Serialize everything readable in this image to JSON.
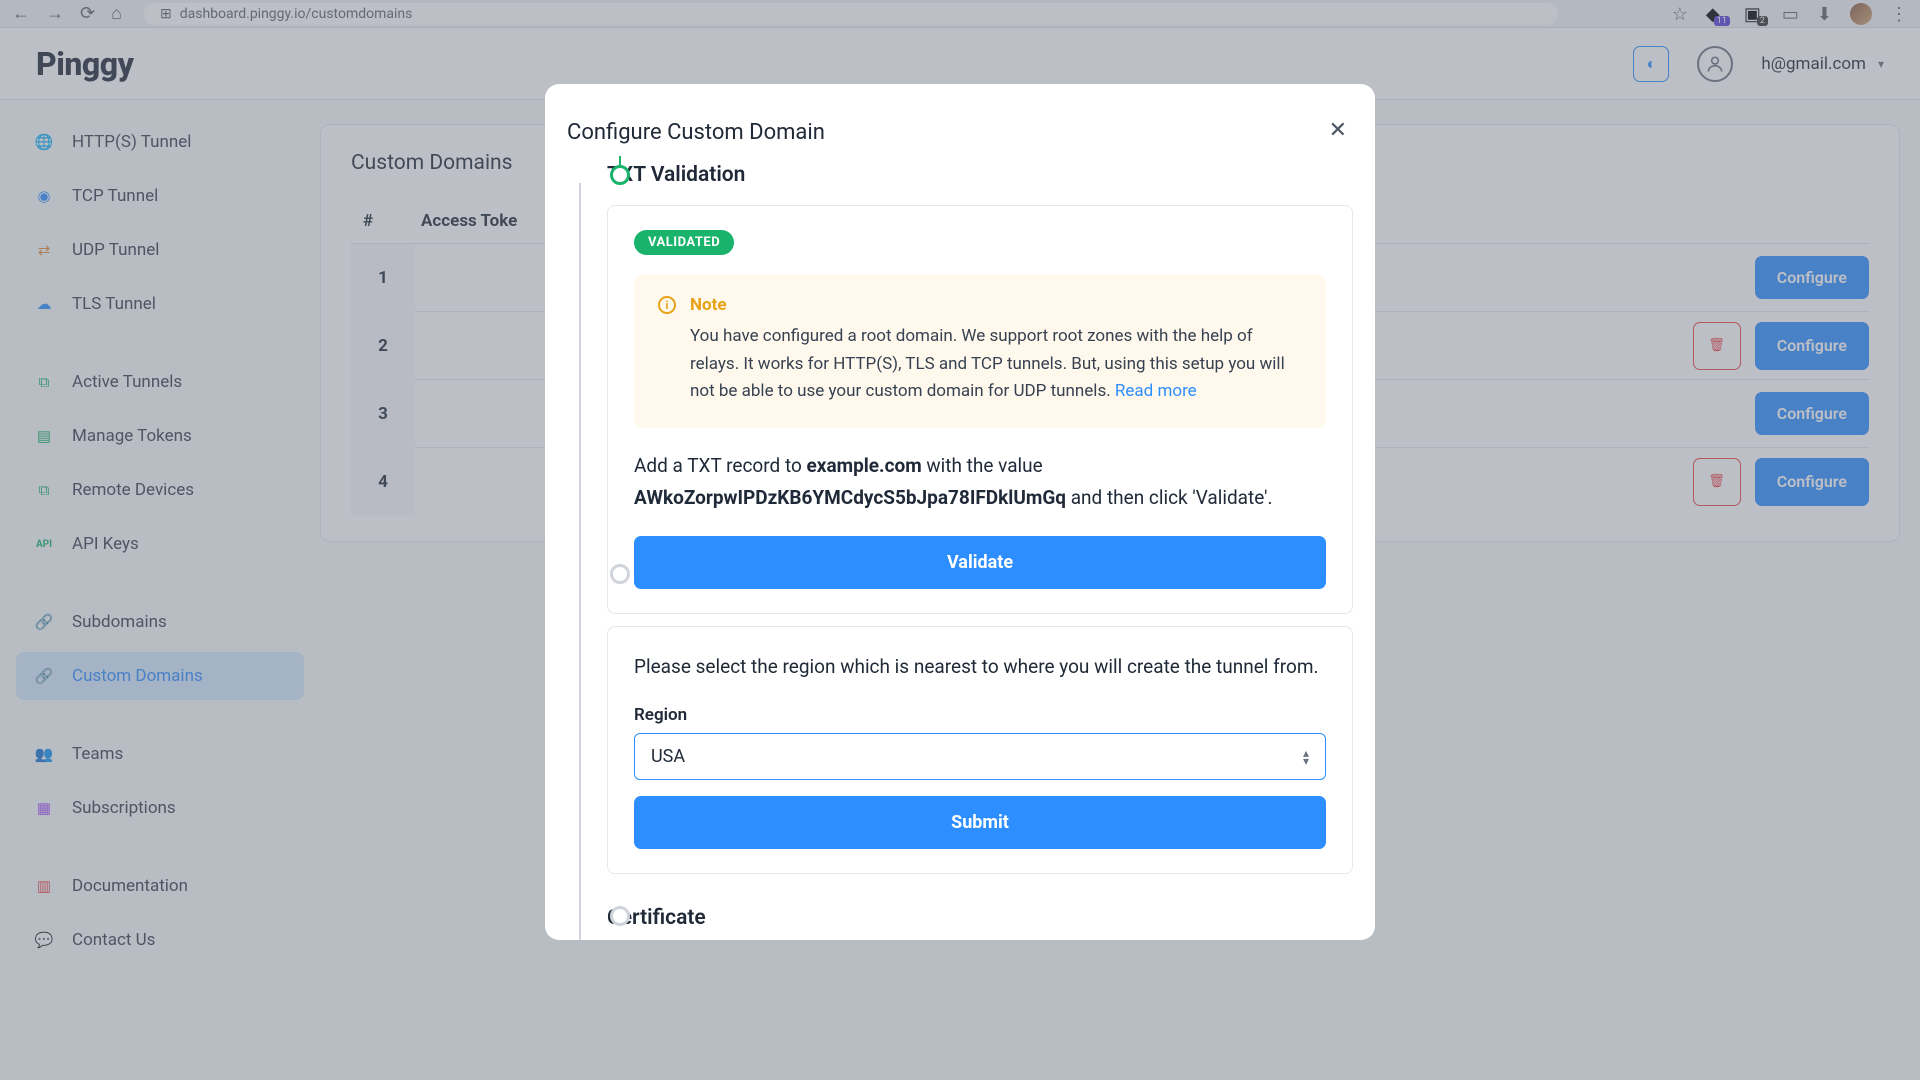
{
  "browser": {
    "url": "dashboard.pinggy.io/customdomains",
    "ext_badge1": "11",
    "ext_badge2": "2"
  },
  "header": {
    "logo": "Pinggy",
    "email": "h@gmail.com"
  },
  "sidebar": {
    "group1": [
      {
        "label": "HTTP(S) Tunnel"
      },
      {
        "label": "TCP Tunnel"
      },
      {
        "label": "UDP Tunnel"
      },
      {
        "label": "TLS Tunnel"
      }
    ],
    "group2": [
      {
        "label": "Active Tunnels"
      },
      {
        "label": "Manage Tokens"
      },
      {
        "label": "Remote Devices"
      },
      {
        "label": "API Keys"
      }
    ],
    "group3": [
      {
        "label": "Subdomains"
      },
      {
        "label": "Custom Domains"
      }
    ],
    "group4": [
      {
        "label": "Teams"
      },
      {
        "label": "Subscriptions"
      }
    ],
    "group5": [
      {
        "label": "Documentation"
      },
      {
        "label": "Contact Us"
      }
    ]
  },
  "page": {
    "title": "Custom Domains",
    "col_num": "#",
    "col_token": "Access Toke",
    "rows": [
      {
        "num": "1",
        "delete": false
      },
      {
        "num": "2",
        "delete": true
      },
      {
        "num": "3",
        "delete": false
      },
      {
        "num": "4",
        "delete": true
      }
    ],
    "configure_label": "Configure"
  },
  "modal": {
    "title": "Configure Custom Domain",
    "step1_title": "TXT Validation",
    "validated_pill": "VALIDATED",
    "note_title": "Note",
    "note_body": "You have configured a root domain. We support root zones with the help of relays. It works for HTTP(S), TLS and TCP tunnels. But, using this setup you will not be able to use your custom domain for UDP tunnels. ",
    "note_link": "Read more",
    "instr_pre": "Add a TXT record to ",
    "instr_domain": "example.com",
    "instr_mid": " with the value ",
    "instr_value": "AWkoZorpwIPDzKB6YMCdycS5bJpa78IFDklUmGq",
    "instr_post": " and then click 'Validate'.",
    "validate_btn": "Validate",
    "region_intro": "Please select the region which is nearest to where you will create the tunnel from.",
    "region_label": "Region",
    "region_value": "USA",
    "submit_btn": "Submit",
    "cert_title": "Certificate"
  }
}
